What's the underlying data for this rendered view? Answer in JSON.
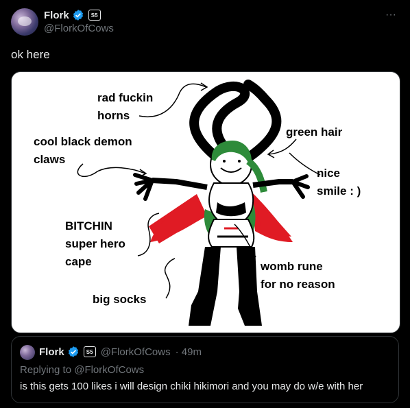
{
  "author": {
    "display_name": "Flork",
    "handle": "@FlorkOfCows",
    "badge_label": "S5"
  },
  "tweet": {
    "text": "ok here",
    "more_label": "···"
  },
  "image_labels": {
    "horns": [
      "rad fuckin",
      "horns"
    ],
    "claws": [
      "cool black demon",
      "claws"
    ],
    "hair": "green hair",
    "smile": [
      "nice",
      "smile : )"
    ],
    "cape": [
      "BITCHIN",
      "super hero",
      "cape"
    ],
    "womb": [
      "womb rune",
      "for no reason"
    ],
    "socks": "big socks"
  },
  "quote": {
    "display_name": "Flork",
    "badge_label": "S5",
    "handle": "@FlorkOfCows",
    "time": "· 49m",
    "replying": "Replying to @FlorkOfCows",
    "text": "is this gets 100 likes i will design chiki hikimori and you may do w/e with her"
  },
  "colors": {
    "background": "#000000",
    "text": "#e7e9ea",
    "muted": "#71767b",
    "verified": "#1d9bf0",
    "border": "#2f3336"
  },
  "icons": [
    "verified-icon",
    "more-icon"
  ]
}
